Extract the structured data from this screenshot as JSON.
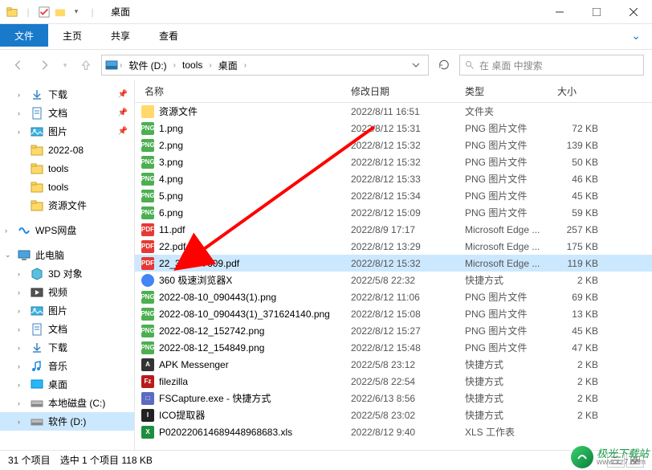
{
  "window": {
    "title": "桌面",
    "controls": {
      "min": "minimize",
      "max": "maximize",
      "close": "close"
    }
  },
  "ribbon": {
    "tabs": [
      "文件",
      "主页",
      "共享",
      "查看"
    ],
    "active_index": 0
  },
  "breadcrumb": {
    "root_icon": "drive",
    "segments": [
      "软件 (D:)",
      "tools",
      "桌面"
    ],
    "search_placeholder": "在 桌面 中搜索"
  },
  "sidebar": {
    "items": [
      {
        "label": "下载",
        "icon": "download",
        "pinned": true,
        "expandable": true,
        "depth": 1
      },
      {
        "label": "文档",
        "icon": "doc",
        "pinned": true,
        "expandable": true,
        "depth": 1
      },
      {
        "label": "图片",
        "icon": "image",
        "pinned": true,
        "expandable": true,
        "depth": 1
      },
      {
        "label": "2022-08",
        "icon": "folder",
        "depth": 1
      },
      {
        "label": "tools",
        "icon": "folder",
        "depth": 1
      },
      {
        "label": "tools",
        "icon": "folder",
        "depth": 1
      },
      {
        "label": "资源文件",
        "icon": "folder",
        "depth": 1
      },
      {
        "gap": true
      },
      {
        "label": "WPS网盘",
        "icon": "wps",
        "expandable": true,
        "depth": 0
      },
      {
        "gap": true
      },
      {
        "label": "此电脑",
        "icon": "pc",
        "expandable": true,
        "expanded": true,
        "depth": 0
      },
      {
        "label": "3D 对象",
        "icon": "3d",
        "expandable": true,
        "depth": 1
      },
      {
        "label": "视频",
        "icon": "video",
        "expandable": true,
        "depth": 1
      },
      {
        "label": "图片",
        "icon": "image",
        "expandable": true,
        "depth": 1
      },
      {
        "label": "文档",
        "icon": "doc",
        "expandable": true,
        "depth": 1
      },
      {
        "label": "下载",
        "icon": "download",
        "expandable": true,
        "depth": 1
      },
      {
        "label": "音乐",
        "icon": "music",
        "expandable": true,
        "depth": 1
      },
      {
        "label": "桌面",
        "icon": "desktop",
        "expandable": true,
        "depth": 1
      },
      {
        "label": "本地磁盘 (C:)",
        "icon": "drive",
        "expandable": true,
        "depth": 1
      },
      {
        "label": "软件 (D:)",
        "icon": "drive",
        "expandable": true,
        "depth": 1,
        "selected": true
      }
    ]
  },
  "columns": {
    "name": "名称",
    "date": "修改日期",
    "type": "类型",
    "size": "大小"
  },
  "files": [
    {
      "icon": "folder",
      "name": "资源文件",
      "date": "2022/8/11 16:51",
      "type": "文件夹",
      "size": ""
    },
    {
      "icon": "png",
      "name": "1.png",
      "date": "2022/8/12 15:31",
      "type": "PNG 图片文件",
      "size": "72 KB"
    },
    {
      "icon": "png",
      "name": "2.png",
      "date": "2022/8/12 15:32",
      "type": "PNG 图片文件",
      "size": "139 KB"
    },
    {
      "icon": "png",
      "name": "3.png",
      "date": "2022/8/12 15:32",
      "type": "PNG 图片文件",
      "size": "50 KB"
    },
    {
      "icon": "png",
      "name": "4.png",
      "date": "2022/8/12 15:33",
      "type": "PNG 图片文件",
      "size": "46 KB"
    },
    {
      "icon": "png",
      "name": "5.png",
      "date": "2022/8/12 15:34",
      "type": "PNG 图片文件",
      "size": "45 KB"
    },
    {
      "icon": "png",
      "name": "6.png",
      "date": "2022/8/12 15:09",
      "type": "PNG 图片文件",
      "size": "59 KB"
    },
    {
      "icon": "pdf",
      "name": "11.pdf",
      "date": "2022/8/9 17:17",
      "type": "Microsoft Edge ...",
      "size": "257 KB"
    },
    {
      "icon": "pdf",
      "name": "22.pdf",
      "date": "2022/8/12 13:29",
      "type": "Microsoft Edge ...",
      "size": "175 KB"
    },
    {
      "icon": "pdf",
      "name": "22_373077609.pdf",
      "date": "2022/8/12 15:32",
      "type": "Microsoft Edge ...",
      "size": "119 KB",
      "selected": true
    },
    {
      "icon": "web",
      "name": "360 极速浏览器X",
      "date": "2022/5/8 22:32",
      "type": "快捷方式",
      "size": "2 KB"
    },
    {
      "icon": "png",
      "name": "2022-08-10_090443(1).png",
      "date": "2022/8/12 11:06",
      "type": "PNG 图片文件",
      "size": "69 KB"
    },
    {
      "icon": "png",
      "name": "2022-08-10_090443(1)_371624140.png",
      "date": "2022/8/12 15:08",
      "type": "PNG 图片文件",
      "size": "13 KB"
    },
    {
      "icon": "png",
      "name": "2022-08-12_152742.png",
      "date": "2022/8/12 15:27",
      "type": "PNG 图片文件",
      "size": "45 KB"
    },
    {
      "icon": "png",
      "name": "2022-08-12_154849.png",
      "date": "2022/8/12 15:48",
      "type": "PNG 图片文件",
      "size": "47 KB"
    },
    {
      "icon": "apk",
      "name": "APK Messenger",
      "date": "2022/5/8 23:12",
      "type": "快捷方式",
      "size": "2 KB"
    },
    {
      "icon": "fz",
      "name": "filezilla",
      "date": "2022/5/8 22:54",
      "type": "快捷方式",
      "size": "2 KB"
    },
    {
      "icon": "exe",
      "name": "FSCapture.exe - 快捷方式",
      "date": "2022/6/13 8:56",
      "type": "快捷方式",
      "size": "2 KB"
    },
    {
      "icon": "ico",
      "name": "ICO提取器",
      "date": "2022/5/8 23:02",
      "type": "快捷方式",
      "size": "2 KB"
    },
    {
      "icon": "xls",
      "name": "P020220614689448968683.xls",
      "date": "2022/8/12 9:40",
      "type": "XLS 工作表",
      "size": ""
    }
  ],
  "status": {
    "count": "31 个项目",
    "selection": "选中 1 个项目 118 KB"
  },
  "watermark": {
    "name": "极光下载站",
    "url": "www.xz7.com"
  }
}
